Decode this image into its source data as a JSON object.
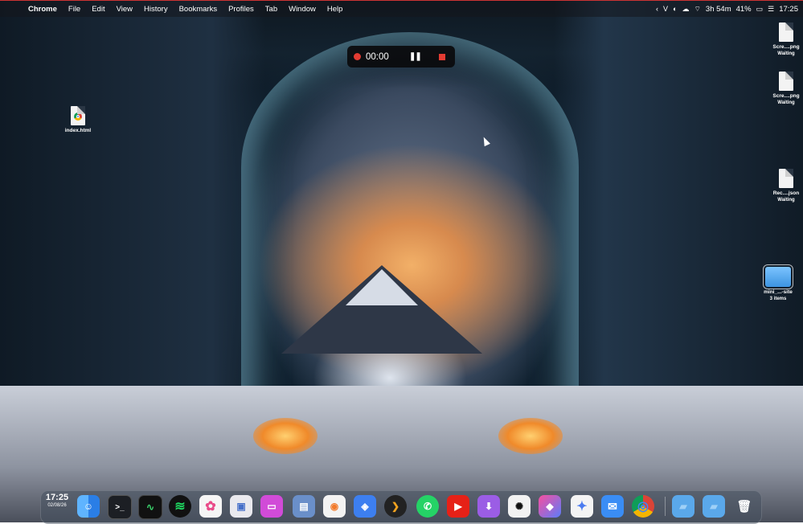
{
  "menubar": {
    "app_name": "Chrome",
    "items": [
      "File",
      "Edit",
      "View",
      "History",
      "Bookmarks",
      "Profiles",
      "Tab",
      "Window",
      "Help"
    ],
    "battery_time": "3h 54m",
    "battery_percent": "41%",
    "clock": "17:25"
  },
  "recorder": {
    "elapsed": "00:00"
  },
  "desktop": {
    "items": [
      {
        "name": "index.html",
        "sub": ""
      },
      {
        "name": "Scre....png",
        "sub": "Waiting"
      },
      {
        "name": "Scre....png",
        "sub": "Waiting"
      },
      {
        "name": "Rec....json",
        "sub": "Waiting"
      },
      {
        "name": "mini_...-site",
        "sub": "3 items"
      }
    ]
  },
  "dock": {
    "clock_time": "17:25",
    "clock_date": "02/08/26",
    "apps": [
      {
        "icon": "finder-icon",
        "glyph": "☺"
      },
      {
        "icon": "terminal-icon",
        "glyph": ">_"
      },
      {
        "icon": "activity-monitor-icon",
        "glyph": "∿"
      },
      {
        "icon": "spotify-icon",
        "glyph": "≋"
      },
      {
        "icon": "photos-icon",
        "glyph": "✿"
      },
      {
        "icon": "preview-icon",
        "glyph": "▣"
      },
      {
        "icon": "screen-sharing-icon",
        "glyph": "▭"
      },
      {
        "icon": "archive-utility-icon",
        "glyph": "▤"
      },
      {
        "icon": "rss-reader-icon",
        "glyph": "◉"
      },
      {
        "icon": "vpn-shield-icon",
        "glyph": "◈"
      },
      {
        "icon": "plex-icon",
        "glyph": "❯"
      },
      {
        "icon": "whatsapp-icon",
        "glyph": "✆"
      },
      {
        "icon": "youtube-icon",
        "glyph": "▶"
      },
      {
        "icon": "downloader-icon",
        "glyph": "⬇"
      },
      {
        "icon": "chatgpt-icon",
        "glyph": "✺"
      },
      {
        "icon": "shortcuts-icon",
        "glyph": "◆"
      },
      {
        "icon": "gemini-icon",
        "glyph": "✦"
      },
      {
        "icon": "mail-icon",
        "glyph": "✉"
      },
      {
        "icon": "chrome-icon",
        "glyph": "◎"
      },
      {
        "icon": "applications-folder-icon",
        "glyph": "▰"
      },
      {
        "icon": "downloads-folder-icon",
        "glyph": "▰"
      },
      {
        "icon": "trash-icon",
        "glyph": "🗑"
      }
    ]
  },
  "colors": {
    "record_red": "#e23b32",
    "folder_blue": "#3c93e0"
  }
}
